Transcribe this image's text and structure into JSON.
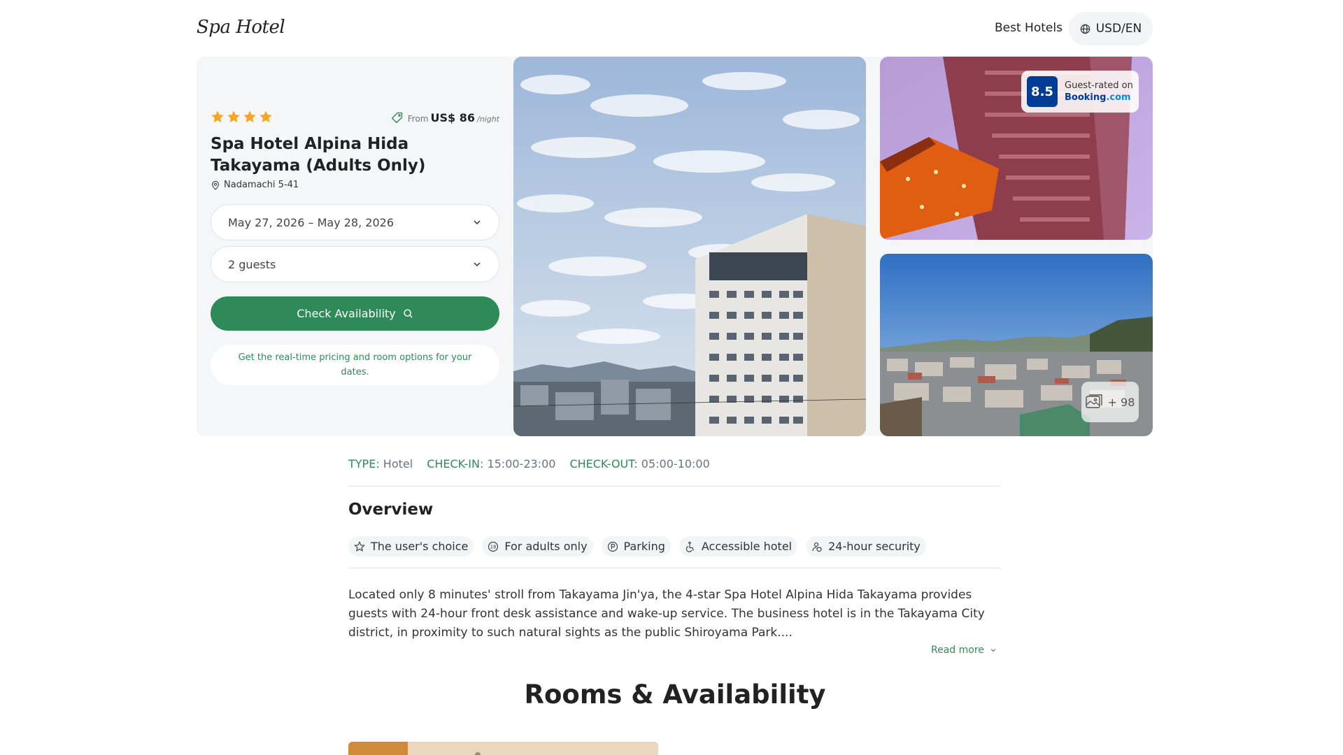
{
  "header": {
    "logo": "Spa Hotel",
    "nav_best_hotels": "Best Hotels",
    "currency": "USD/EN",
    "currency_icon": "globe-icon"
  },
  "hotel": {
    "stars": 4,
    "price_from_label": "From",
    "price_amount": "US$ 86",
    "price_per": "/night",
    "name": "Spa Hotel Alpina Hida Takayama (Adults Only)",
    "address": "Nadamachi 5-41"
  },
  "search": {
    "dates": "May 27, 2026 – May 28, 2026",
    "guests": "2 guests",
    "check_button": "Check Availability",
    "note": "Get the real-time pricing and room options for your dates."
  },
  "rating": {
    "score": "8.5",
    "label": "Guest-rated on",
    "brand_main": "Booking",
    "brand_tld": ".com"
  },
  "gallery": {
    "more_count": "+ 98"
  },
  "meta": {
    "type_key": "TYPE",
    "type_val": "Hotel",
    "checkin_key": "CHECK-IN",
    "checkin_val": "15:00-23:00",
    "checkout_key": "CHECK-OUT",
    "checkout_val": "05:00-10:00"
  },
  "overview": {
    "title": "Overview",
    "chips": [
      {
        "label": "The user's choice",
        "icon": "star-outline-icon"
      },
      {
        "label": "For adults only",
        "icon": "adults-18-icon"
      },
      {
        "label": "Parking",
        "icon": "parking-icon"
      },
      {
        "label": "Accessible hotel",
        "icon": "wheelchair-icon"
      },
      {
        "label": "24-hour security",
        "icon": "security-guard-icon"
      }
    ],
    "description": "Located only 8 minutes' stroll from Takayama Jin'ya, the 4-star Spa Hotel Alpina Hida Takayama provides guests with 24-hour front desk assistance and wake-up service. The business hotel is in the Takayama City district, in proximity to such natural sights as the public Shiroyama Park....",
    "read_more": "Read more"
  },
  "rooms": {
    "title": "Rooms & Availability"
  },
  "colors": {
    "accent_green": "#2e8b57",
    "star_orange": "#f5a623",
    "booking_blue": "#003b95"
  }
}
